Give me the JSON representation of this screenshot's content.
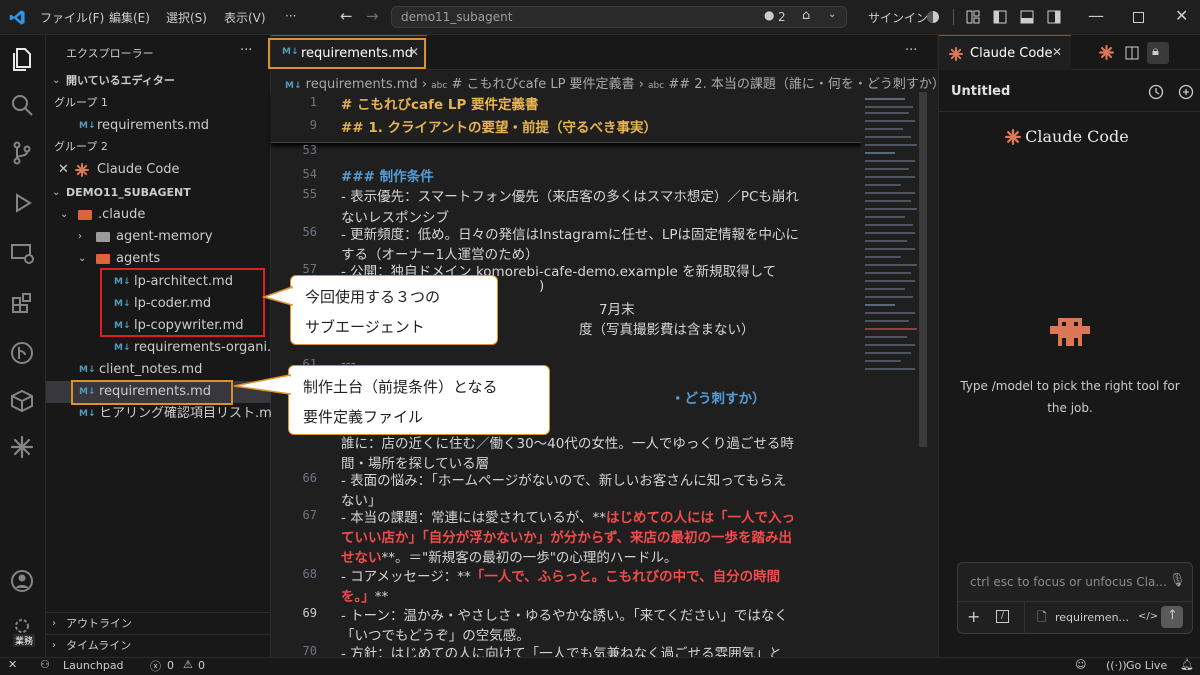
{
  "titlebar": {
    "menus": [
      "ファイル(F)",
      "編集(E)",
      "選択(S)",
      "表示(V)",
      "···"
    ],
    "search_text": "demo11_subagent",
    "badge_count": "2",
    "signin": "サインイン"
  },
  "sidebar": {
    "title": "エクスプローラー",
    "more": "···",
    "open_editors": "開いているエディター",
    "group1": "グループ 1",
    "group1_file": "requirements.md",
    "group2": "グループ 2",
    "group2_file": "Claude Code",
    "project": "DEMO11_SUBAGENT",
    "tree": {
      "claude": ".claude",
      "agent_memory": "agent-memory",
      "agents": "agents",
      "lp_architect": "lp-architect.md",
      "lp_coder": "lp-coder.md",
      "lp_copywriter": "lp-copywriter.md",
      "req_org": "requirements-organi...",
      "client_notes": "client_notes.md",
      "requirements": "requirements.md",
      "hearing": "ヒアリング確認項目リスト.md"
    },
    "outline": "アウトライン",
    "timeline": "タイムライン",
    "md_icon": "M↓"
  },
  "editor": {
    "tab_label": "requirements.md",
    "breadcrumb": [
      "requirements.md",
      "# こもれびcafe LP 要件定義書",
      "## 2. 本当の課題（誰に・何を・どう刺すか）"
    ],
    "sticky1_no": "1",
    "sticky1": "# こもれびcafe LP 要件定義書",
    "sticky2_no": "9",
    "sticky2": "## 1. クライアントの要望・前提（守るべき事実）",
    "lines": [
      {
        "no": "53",
        "text": ""
      },
      {
        "no": "54",
        "text": "### 制作条件"
      },
      {
        "no": "55",
        "text": "- 表示優先：スマートフォン優先（来店客の多くはスマホ想定）／PCも崩れ"
      },
      {
        "no": "",
        "text": "ないレスポンシブ"
      },
      {
        "no": "56",
        "text": "- 更新頻度：低め。日々の発信はInstagramに任せ、LPは固定情報を中心に"
      },
      {
        "no": "",
        "text": "する（オーナー1人運営のため）"
      },
      {
        "no": "57",
        "text": "- 公開：独自ドメイン komorebi-cafe-demo.example を新規取得して"
      },
      {
        "no": "61",
        "text": "---"
      },
      {
        "no": "65",
        "text": "  誰に：店の近くに住む／働く30〜40代の女性。一人でゆっくり過ごせる時"
      },
      {
        "no": "",
        "text": "間・場所を探している層"
      },
      {
        "no": "66",
        "text": "- 表面の悩み：「ホームページがないので、新しいお客さんに知ってもらえ"
      },
      {
        "no": "",
        "text": "ない」"
      },
      {
        "no": "67",
        "text": "- 本当の課題：常連には愛されているが、**"
      },
      {
        "no": "68",
        "text": "- コアメッセージ：**"
      },
      {
        "no": "69",
        "text": "- トーン：温かみ・やさしさ・ゆるやかな誘い。「来てください」ではなく"
      },
      {
        "no": "",
        "text": "「いつでもどうぞ」の空気感。"
      },
      {
        "no": "70",
        "text": "- 方針：はじめての人に向けて「一人でも気兼ねなく過ごせる雰囲気」と"
      }
    ],
    "partial": {
      "l58": ")",
      "l59": "7月末",
      "l60": "度（写真撮影費は含まない）",
      "l62": "・どう刺すか）"
    },
    "red67a": "はじめての人には「一人で入っ",
    "red67b": "ていい店か」「自分が浮かないか」が分からず、来店の最初の一歩を踏み出",
    "red67c": "せない",
    "tail67c": "**。＝\"新規客の最初の一歩\"の心理的ハードル。",
    "red68a": "「一人で、ふらっと。こもれびの中で、自分の時間",
    "red68b": "を。」",
    "tail68b": "**"
  },
  "callouts": {
    "c1_line1": "今回使用する３つの",
    "c1_line2": "サブエージェント",
    "c2_line1": "制作土台（前提条件）となる",
    "c2_line2": "要件定義ファイル"
  },
  "panel": {
    "tab": "Claude Code",
    "session": "Untitled",
    "logo_text": "Claude Code",
    "hint": "Type /model to pick the right tool for the job.",
    "input_placeholder": "ctrl esc to focus or unfocus Cla...",
    "file_chip": "requiremen...",
    "code_icon": "</>"
  },
  "statusbar": {
    "launchpad": "Launchpad",
    "errors": "0",
    "warnings": "0",
    "golive": "Go Live"
  },
  "activity": {
    "account_badge": "業務"
  },
  "colors": {
    "accent": "#0078d4",
    "highlight_box_red": "#e02020",
    "highlight_box_orange": "#e0902a",
    "claude_orange": "#d97757"
  }
}
